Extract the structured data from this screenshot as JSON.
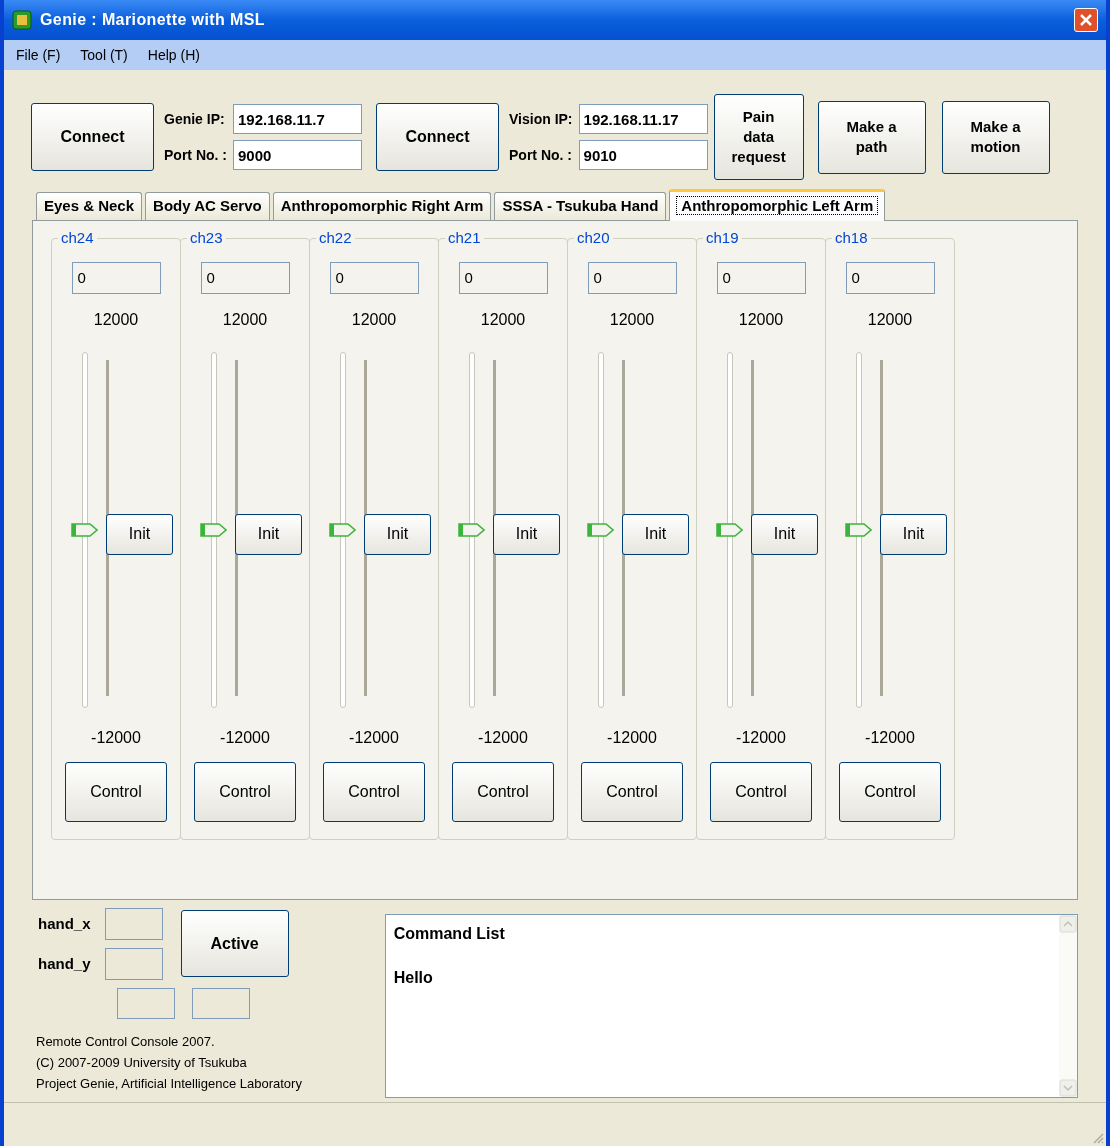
{
  "window": {
    "title": "Genie : Marionette with MSL"
  },
  "menu": [
    "File (F)",
    "Tool (T)",
    "Help (H)"
  ],
  "connections": [
    {
      "button": "Connect",
      "ip_label": "Genie IP:",
      "ip": "192.168.11.7",
      "port_label": "Port No. :",
      "port": "9000"
    },
    {
      "button": "Connect",
      "ip_label": "Vision IP:",
      "ip": "192.168.11.17",
      "port_label": "Port No. :",
      "port": "9010"
    }
  ],
  "actions": [
    "Pain data request",
    "Make a path",
    "Make a motion"
  ],
  "tabs": [
    {
      "label": "Eyes & Neck",
      "selected": false
    },
    {
      "label": "Body AC Servo",
      "selected": false
    },
    {
      "label": "Anthropomorphic Right Arm",
      "selected": false
    },
    {
      "label": "SSSA - Tsukuba Hand",
      "selected": false
    },
    {
      "label": "Anthropomorphic Left Arm",
      "selected": true
    }
  ],
  "channels": [
    {
      "name": "ch24",
      "value": "0",
      "max": "12000",
      "min": "-12000",
      "level": 0.5,
      "init": "Init",
      "control": "Control"
    },
    {
      "name": "ch23",
      "value": "0",
      "max": "12000",
      "min": "-12000",
      "level": 0.5,
      "init": "Init",
      "control": "Control"
    },
    {
      "name": "ch22",
      "value": "0",
      "max": "12000",
      "min": "-12000",
      "level": 0.5,
      "init": "Init",
      "control": "Control"
    },
    {
      "name": "ch21",
      "value": "0",
      "max": "12000",
      "min": "-12000",
      "level": 0.5,
      "init": "Init",
      "control": "Control"
    },
    {
      "name": "ch20",
      "value": "0",
      "max": "12000",
      "min": "-12000",
      "level": 0.5,
      "init": "Init",
      "control": "Control"
    },
    {
      "name": "ch19",
      "value": "0",
      "max": "12000",
      "min": "-12000",
      "level": 0.5,
      "init": "Init",
      "control": "Control"
    },
    {
      "name": "ch18",
      "value": "0",
      "max": "12000",
      "min": "-12000",
      "level": 0.5,
      "init": "Init",
      "control": "Control"
    }
  ],
  "hand": {
    "x_label": "hand_x",
    "y_label": "hand_y",
    "button": "Active"
  },
  "footer": [
    "Remote Control Console 2007.",
    "(C) 2007-2009 University of Tsukuba",
    "Project Genie, Artificial Intelligence Laboratory"
  ],
  "command_list": {
    "lines": [
      "Command List",
      "Hello"
    ]
  }
}
